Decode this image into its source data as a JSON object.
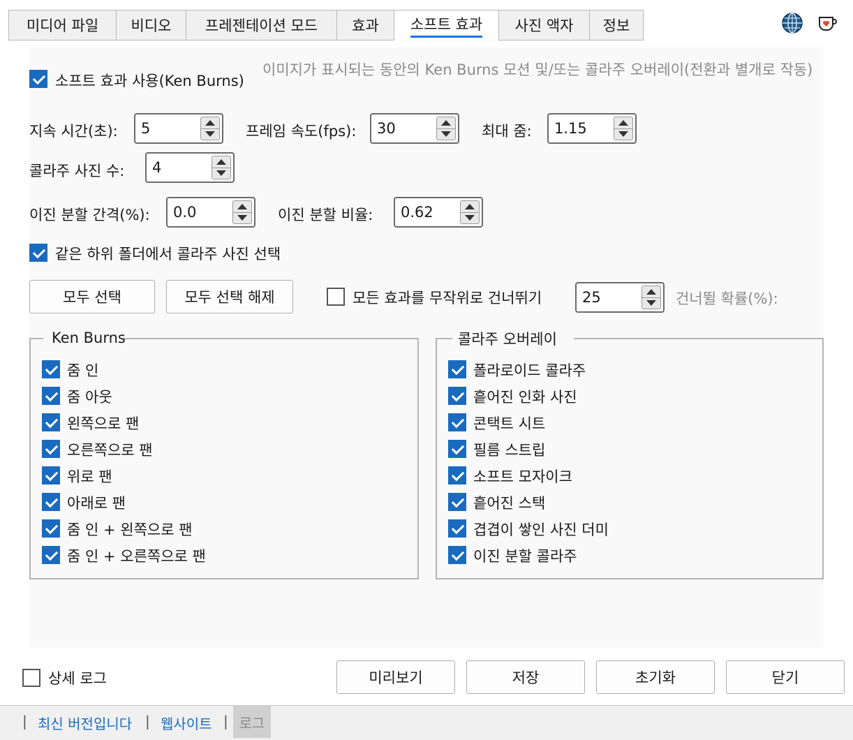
{
  "tabs": [
    {
      "label": "미디어 파일"
    },
    {
      "label": "비디오"
    },
    {
      "label": "프레젠테이션 모드"
    },
    {
      "label": "효과"
    },
    {
      "label": "소프트 효과"
    },
    {
      "label": "사진 액자"
    },
    {
      "label": "정보"
    }
  ],
  "active_tab": "소프트 효과",
  "top_icons": [
    "globe-icon",
    "heart-cup-icon"
  ],
  "soft_effect": {
    "enable_label": "소프트 효과 사용(Ken Burns)",
    "enable_checked": true,
    "hint": "이미지가 표시되는 동안의 Ken Burns 모션 및/또는 콜라주 오버레이(전환과 별개로 작동)"
  },
  "fields": {
    "duration_label": "지속 시간(초):",
    "duration_value": "5",
    "fps_label": "프레임 속도(fps):",
    "fps_value": "30",
    "maxzoom_label": "최대 줌:",
    "maxzoom_value": "1.15",
    "collage_count_label": "콜라주 사진 수:",
    "collage_count_value": "4",
    "bsp_gap_label": "이진 분할 간격(%):",
    "bsp_gap_value": "0.0",
    "bsp_ratio_label": "이진 분할 비율:",
    "bsp_ratio_value": "0.62"
  },
  "same_folder": {
    "label": "같은 하위 폴더에서 콜라주 사진 선택",
    "checked": true
  },
  "buttons": {
    "select_all": "모두 선택",
    "deselect_all": "모두 선택 해제"
  },
  "random_skip": {
    "label": "모든 효과를 무작위로 건너뛰기",
    "checked": false,
    "value": "25",
    "prob_label": "건너뛸 확률(%):"
  },
  "ken_burns": {
    "title": "Ken Burns",
    "items": [
      {
        "label": "줌 인",
        "checked": true
      },
      {
        "label": "줌 아웃",
        "checked": true
      },
      {
        "label": "왼쪽으로 팬",
        "checked": true
      },
      {
        "label": "오른쪽으로 팬",
        "checked": true
      },
      {
        "label": "위로 팬",
        "checked": true
      },
      {
        "label": "아래로 팬",
        "checked": true
      },
      {
        "label": "줌 인 + 왼쪽으로 팬",
        "checked": true
      },
      {
        "label": "줌 인 + 오른쪽으로 팬",
        "checked": true
      }
    ]
  },
  "collage_overlay": {
    "title": "콜라주 오버레이",
    "items": [
      {
        "label": "폴라로이드 콜라주",
        "checked": true
      },
      {
        "label": "흩어진 인화 사진",
        "checked": true
      },
      {
        "label": "콘택트 시트",
        "checked": true
      },
      {
        "label": "필름 스트립",
        "checked": true
      },
      {
        "label": "소프트 모자이크",
        "checked": true
      },
      {
        "label": "흩어진 스택",
        "checked": true
      },
      {
        "label": "겹겹이 쌓인 사진 더미",
        "checked": true
      },
      {
        "label": "이진 분할 콜라주",
        "checked": true
      }
    ]
  },
  "verbose_log": {
    "label": "상세 로그",
    "checked": false
  },
  "bottom_buttons": {
    "preview": "미리보기",
    "save": "저장",
    "reset": "초기화",
    "close": "닫기"
  },
  "footer": {
    "sep": "|",
    "latest": "최신 버전입니다",
    "website": "웹사이트",
    "log": "로그"
  }
}
